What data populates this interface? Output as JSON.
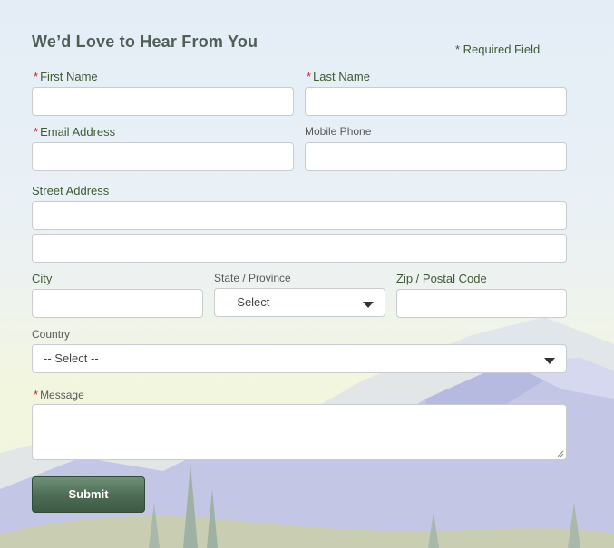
{
  "form": {
    "title": "We’d Love to Hear From You",
    "required_note": "* Required Field",
    "required_marker": "*",
    "fields": {
      "first_name": {
        "label": "First Name",
        "value": ""
      },
      "last_name": {
        "label": "Last Name",
        "value": ""
      },
      "email": {
        "label": "Email Address",
        "value": ""
      },
      "mobile_phone": {
        "label": "Mobile Phone",
        "value": ""
      },
      "street_address": {
        "label": "Street Address",
        "value": ""
      },
      "city": {
        "label": "City",
        "value": ""
      },
      "state": {
        "label": "State / Province",
        "selected": "-- Select --"
      },
      "zip": {
        "label": "Zip / Postal Code",
        "value": ""
      },
      "country": {
        "label": "Country",
        "selected": "-- Select --"
      },
      "message": {
        "label": "Message",
        "value": ""
      }
    },
    "submit_label": "Submit"
  },
  "colors": {
    "label_green": "#3f5a34",
    "required_red": "#cc2222",
    "button_green": "#4c6b54",
    "title_gray": "#4f5f57"
  }
}
